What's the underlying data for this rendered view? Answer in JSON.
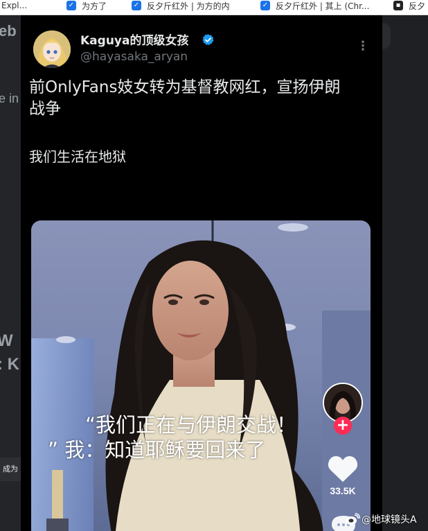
{
  "browser": {
    "bookmarks": [
      {
        "label": "Expl...",
        "icon": "page-icon"
      },
      {
        "label": "为方了",
        "icon": "bookmark-icon"
      },
      {
        "label": "反夕斤红外 | 为方的内",
        "icon": "bookmark-icon"
      },
      {
        "label": "反夕斤红外 | 其上 (Chr...",
        "icon": "bookmark-icon"
      },
      {
        "label": "反夕",
        "icon": "bookmark-icon"
      }
    ]
  },
  "background_page": {
    "fragments": [
      "eb",
      "e in",
      "W",
      ": K"
    ],
    "left_button": "成为"
  },
  "tweet": {
    "author": {
      "display_name": "Kaguya的顶级女孩",
      "handle": "@hayasaka_aryan",
      "verified": true
    },
    "title": "前OnlyFans妓女转为基督教网红，宣扬伊朗战争",
    "subtitle": "我们生活在地狱",
    "video": {
      "caption_line1": "“我们正在与伊朗交战！",
      "caption_line2": "”  我：知道耶稣要回来了",
      "like_count": "33.5K",
      "accent_color": "#fe2c55"
    }
  },
  "watermark": {
    "text": "@地球镜头A",
    "icon": "weibo-icon"
  },
  "colors": {
    "tweet_background": "#000000",
    "primary_text": "#e7e9ea",
    "secondary_text": "#71767b",
    "verified_badge": "#1d9bf0"
  }
}
